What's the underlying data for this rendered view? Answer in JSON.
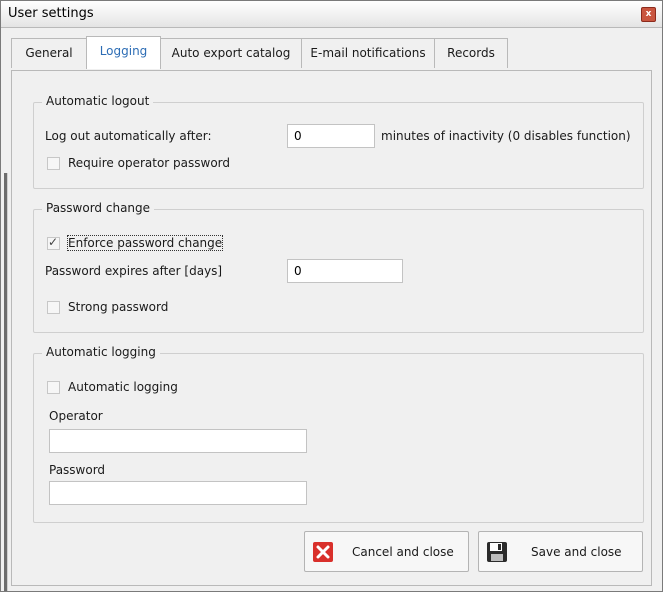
{
  "window": {
    "title": "User settings"
  },
  "tabs": [
    {
      "label": "General"
    },
    {
      "label": "Logging"
    },
    {
      "label": "Auto export catalog"
    },
    {
      "label": "E-mail notifications"
    },
    {
      "label": "Records"
    }
  ],
  "automatic_logout": {
    "legend": "Automatic logout",
    "logout_label": "Log out automatically after:",
    "logout_value": "0",
    "logout_suffix": "minutes of inactivity (0 disables function)",
    "require_password_label": "Require operator password",
    "require_password_checked": false
  },
  "password_change": {
    "legend": "Password change",
    "enforce_label": "Enforce password change",
    "enforce_checked": true,
    "expires_label": "Password expires after [days]",
    "expires_value": "0",
    "strong_label": "Strong password",
    "strong_checked": false
  },
  "automatic_logging": {
    "legend": "Automatic logging",
    "auto_label": "Automatic logging",
    "auto_checked": false,
    "operator_label": "Operator",
    "operator_value": "",
    "password_label": "Password",
    "password_value": ""
  },
  "buttons": {
    "cancel_label": "Cancel and close",
    "save_label": "Save and close"
  },
  "colors": {
    "active_tab_text": "#2d6db5",
    "cancel_icon": "#d9302b"
  }
}
